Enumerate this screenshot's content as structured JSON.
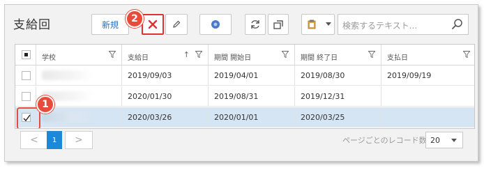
{
  "page": {
    "title": "支給回"
  },
  "toolbar": {
    "new_label": "新規",
    "delete_tooltip": "削除",
    "search_placeholder": "検索するテキスト..."
  },
  "annotations": {
    "badge_1": "1",
    "badge_2": "2"
  },
  "table": {
    "columns": [
      "学校",
      "支給日",
      "期間 開始日",
      "期間 終了日",
      "支払日"
    ],
    "sort_indicator": "↑",
    "rows": [
      {
        "school": "",
        "pay_date": "2019/09/03",
        "start": "2019/04/01",
        "end": "2019/08/30",
        "paid": "2019/09/19",
        "checked": false,
        "selected": false
      },
      {
        "school": "",
        "pay_date": "2020/01/30",
        "start": "2019/08/31",
        "end": "2019/12/31",
        "paid": "",
        "checked": false,
        "selected": false
      },
      {
        "school": "",
        "pay_date": "2020/03/26",
        "start": "2020/01/01",
        "end": "2020/03/25",
        "paid": "",
        "checked": true,
        "selected": true
      }
    ]
  },
  "pager": {
    "prev": "<",
    "current": "1",
    "next": ">",
    "per_page_label": "ページごとのレコード数",
    "per_page_value": "20"
  },
  "colors": {
    "accent": "#1e88d8",
    "danger": "#e03030",
    "badge": "#e84a3c",
    "selected_row": "#d6e5f3"
  }
}
